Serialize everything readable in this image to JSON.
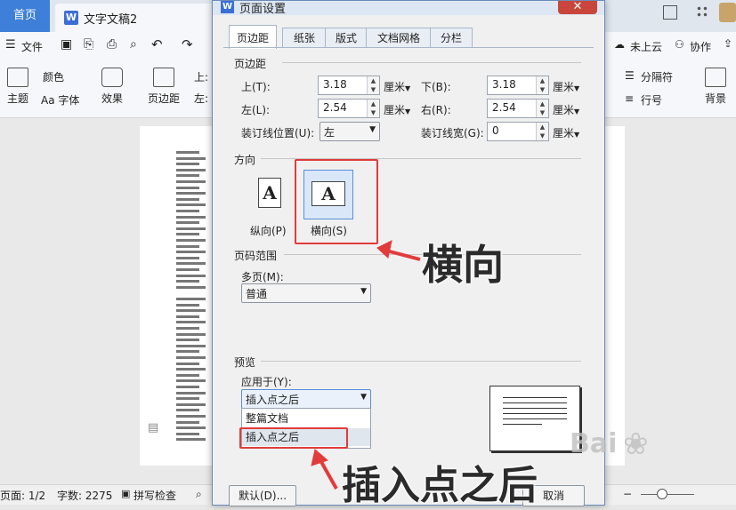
{
  "app": {
    "home_tab": "首页",
    "doc_tab": "文字文稿2",
    "doc_icon": "W",
    "menu_file": "文件",
    "ribbon": {
      "color_label": "颜色",
      "theme_label": "主题",
      "font_label": "Aa 字体",
      "effect_label": "效果",
      "margin_label": "页边距",
      "top_label": "上:",
      "left_label": "左:",
      "cloud_label": "未上云",
      "collab_label": "协作",
      "separator_label": "分隔符",
      "linenum_label": "行号",
      "background_label": "背景"
    },
    "status": {
      "page": "页面: 1/2",
      "words": "字数: 2275",
      "spellcheck": "拼写检查"
    }
  },
  "dialog": {
    "icon": "W",
    "title": "页面设置",
    "close": "✕",
    "tabs": [
      "页边距",
      "纸张",
      "版式",
      "文档网格",
      "分栏"
    ],
    "margins_section": "页边距",
    "top_label": "上(T):",
    "top_value": "3.18",
    "bottom_label": "下(B):",
    "bottom_value": "3.18",
    "left_label": "左(L):",
    "left_value": "2.54",
    "right_label": "右(R):",
    "right_value": "2.54",
    "unit": "厘米",
    "gutter_pos_label": "装订线位置(U):",
    "gutter_pos_value": "左",
    "gutter_width_label": "装订线宽(G):",
    "gutter_width_value": "0",
    "orientation_section": "方向",
    "portrait_label": "纵向(P)",
    "landscape_label": "横向(S)",
    "paper_letter": "A",
    "pages_section": "页码范围",
    "multi_pages_label": "多页(M):",
    "multi_pages_value": "普通",
    "preview_section": "预览",
    "apply_label": "应用于(Y):",
    "apply_value": "插入点之后",
    "apply_options": [
      "整篇文档",
      "插入点之后"
    ],
    "default_button": "默认(D)...",
    "cancel_button": "取消"
  },
  "annotations": {
    "landscape_callout": "横向",
    "insert_callout": "插入点之后"
  },
  "colors": {
    "accent": "#3d7fd9",
    "highlight": "#e23b3b",
    "close": "#c9463d"
  }
}
